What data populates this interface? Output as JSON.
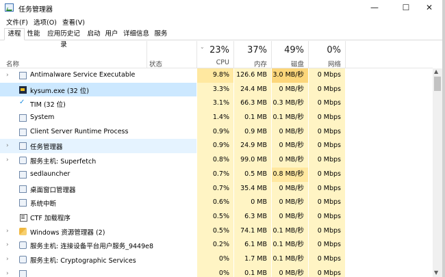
{
  "window": {
    "title": "任务管理器",
    "controls": {
      "minimize": "—",
      "maximize": "☐",
      "close": "✕"
    }
  },
  "menu": [
    "文件(F)",
    "选项(O)",
    "查看(V)"
  ],
  "tabs": [
    "进程",
    "性能",
    "应用历史记录",
    "启动",
    "用户",
    "详细信息",
    "服务"
  ],
  "active_tab": "进程",
  "columns": {
    "name": "名称",
    "status": "状态",
    "cpu": {
      "pct": "23%",
      "label": "CPU"
    },
    "mem": {
      "pct": "37%",
      "label": "内存"
    },
    "disk": {
      "pct": "49%",
      "label": "磁盘"
    },
    "net": {
      "pct": "0%",
      "label": "网络"
    }
  },
  "rows": [
    {
      "name": "Antimalware Service Executable",
      "icon": "service-window-icon",
      "expandable": true,
      "cpu": "9.8%",
      "mem": "126.6 MB",
      "disk": "3.0 MB/秒",
      "net": "0 Mbps",
      "cpu_level": 2,
      "mem_level": 1,
      "disk_level": 3
    },
    {
      "name": "kysum.exe (32 位)",
      "icon": "kysum-app-icon",
      "expandable": false,
      "cpu": "3.3%",
      "mem": "24.4 MB",
      "disk": "0 MB/秒",
      "net": "0 Mbps",
      "cpu_level": 1,
      "mem_level": 1,
      "disk_level": 1,
      "selected": true
    },
    {
      "name": "TIM (32 位)",
      "icon": "tim-app-icon",
      "expandable": false,
      "cpu": "3.1%",
      "mem": "66.3 MB",
      "disk": "0.3 MB/秒",
      "net": "0 Mbps",
      "cpu_level": 1,
      "mem_level": 1,
      "disk_level": 1
    },
    {
      "name": "System",
      "icon": "system-window-icon",
      "expandable": false,
      "cpu": "1.4%",
      "mem": "0.1 MB",
      "disk": "0.1 MB/秒",
      "net": "0 Mbps",
      "cpu_level": 1,
      "mem_level": 1,
      "disk_level": 1
    },
    {
      "name": "Client Server Runtime Process",
      "icon": "system-window-icon",
      "expandable": false,
      "cpu": "0.9%",
      "mem": "0.9 MB",
      "disk": "0 MB/秒",
      "net": "0 Mbps",
      "cpu_level": 1,
      "mem_level": 1,
      "disk_level": 1
    },
    {
      "name": "任务管理器",
      "icon": "task-manager-icon",
      "expandable": true,
      "cpu": "0.9%",
      "mem": "24.9 MB",
      "disk": "0 MB/秒",
      "net": "0 Mbps",
      "cpu_level": 1,
      "mem_level": 1,
      "disk_level": 1,
      "hover": true
    },
    {
      "name": "服务主机: Superfetch",
      "icon": "gear-icon",
      "expandable": true,
      "cpu": "0.8%",
      "mem": "99.0 MB",
      "disk": "0 MB/秒",
      "net": "0 Mbps",
      "cpu_level": 1,
      "mem_level": 1,
      "disk_level": 1
    },
    {
      "name": "sedlauncher",
      "icon": "system-window-icon",
      "expandable": false,
      "cpu": "0.7%",
      "mem": "0.5 MB",
      "disk": "0.8 MB/秒",
      "net": "0 Mbps",
      "cpu_level": 1,
      "mem_level": 1,
      "disk_level": 2
    },
    {
      "name": "桌面窗口管理器",
      "icon": "system-window-icon",
      "expandable": false,
      "cpu": "0.7%",
      "mem": "35.4 MB",
      "disk": "0 MB/秒",
      "net": "0 Mbps",
      "cpu_level": 1,
      "mem_level": 1,
      "disk_level": 1
    },
    {
      "name": "系统中断",
      "icon": "system-window-icon",
      "expandable": false,
      "cpu": "0.6%",
      "mem": "0 MB",
      "disk": "0 MB/秒",
      "net": "0 Mbps",
      "cpu_level": 1,
      "mem_level": 1,
      "disk_level": 1
    },
    {
      "name": "CTF 加载程序",
      "icon": "ctf-loader-icon",
      "expandable": false,
      "cpu": "0.5%",
      "mem": "6.3 MB",
      "disk": "0 MB/秒",
      "net": "0 Mbps",
      "cpu_level": 1,
      "mem_level": 1,
      "disk_level": 1
    },
    {
      "name": "Windows 资源管理器 (2)",
      "icon": "folder-icon",
      "expandable": true,
      "cpu": "0.5%",
      "mem": "74.1 MB",
      "disk": "0.1 MB/秒",
      "net": "0 Mbps",
      "cpu_level": 1,
      "mem_level": 1,
      "disk_level": 1
    },
    {
      "name": "服务主机: 连接设备平台用户服务_9449e8",
      "icon": "gear-icon",
      "expandable": true,
      "cpu": "0.2%",
      "mem": "6.1 MB",
      "disk": "0.1 MB/秒",
      "net": "0 Mbps",
      "cpu_level": 1,
      "mem_level": 1,
      "disk_level": 1
    },
    {
      "name": "服务主机: Cryptographic Services",
      "icon": "gear-icon",
      "expandable": true,
      "cpu": "0%",
      "mem": "1.7 MB",
      "disk": "0.1 MB/秒",
      "net": "0 Mbps",
      "cpu_level": 1,
      "mem_level": 1,
      "disk_level": 1
    },
    {
      "name": "",
      "icon": "system-window-icon",
      "expandable": true,
      "cpu": "0%",
      "mem": "0.1 MB",
      "disk": "0 MB/秒",
      "net": "0 Mbps",
      "cpu_level": 1,
      "mem_level": 1,
      "disk_level": 1
    }
  ],
  "colors": {
    "heat_1": "#fff4c4",
    "heat_2": "#ffe8a0",
    "heat_3": "#fcd67a",
    "selection": "#cce8ff",
    "hover": "#e5f3ff"
  }
}
